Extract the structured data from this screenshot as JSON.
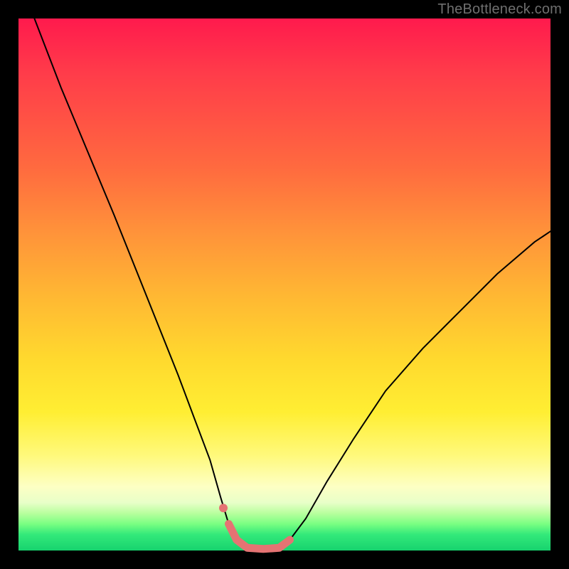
{
  "watermark": {
    "text": "TheBottleneck.com"
  },
  "chart_data": {
    "type": "line",
    "title": "",
    "xlabel": "",
    "ylabel": "",
    "xlim": [
      0,
      100
    ],
    "ylim": [
      0,
      100
    ],
    "grid": false,
    "legend": false,
    "background_gradient": {
      "orientation": "vertical",
      "stops": [
        {
          "pos": 0.0,
          "color": "#ff1a4d"
        },
        {
          "pos": 0.28,
          "color": "#ff6a3f"
        },
        {
          "pos": 0.52,
          "color": "#ffb733"
        },
        {
          "pos": 0.74,
          "color": "#ffee33"
        },
        {
          "pos": 0.88,
          "color": "#fdffc4"
        },
        {
          "pos": 0.95,
          "color": "#7aff82"
        },
        {
          "pos": 1.0,
          "color": "#17d36e"
        }
      ]
    },
    "series": [
      {
        "name": "bottleneck-curve",
        "color": "#000000",
        "x": [
          3,
          8,
          13,
          18,
          22,
          26,
          30,
          33,
          36,
          38,
          39.5,
          41,
          43,
          46,
          49,
          51,
          54,
          58,
          63,
          69,
          76,
          83,
          90,
          97,
          100
        ],
        "y": [
          100,
          87,
          75,
          63,
          53,
          43,
          33,
          25,
          17,
          10,
          5,
          2,
          0.5,
          0.3,
          0.5,
          2,
          6,
          13,
          21,
          30,
          38,
          45,
          52,
          58,
          60
        ]
      },
      {
        "name": "optimal-band",
        "color": "#e57373",
        "x": [
          39.5,
          41,
          43,
          46,
          49,
          51
        ],
        "y": [
          5,
          2,
          0.5,
          0.3,
          0.5,
          2
        ]
      }
    ],
    "markers": [
      {
        "name": "optimal-dot",
        "x": 38.5,
        "y": 8,
        "color": "#e57373"
      }
    ]
  }
}
